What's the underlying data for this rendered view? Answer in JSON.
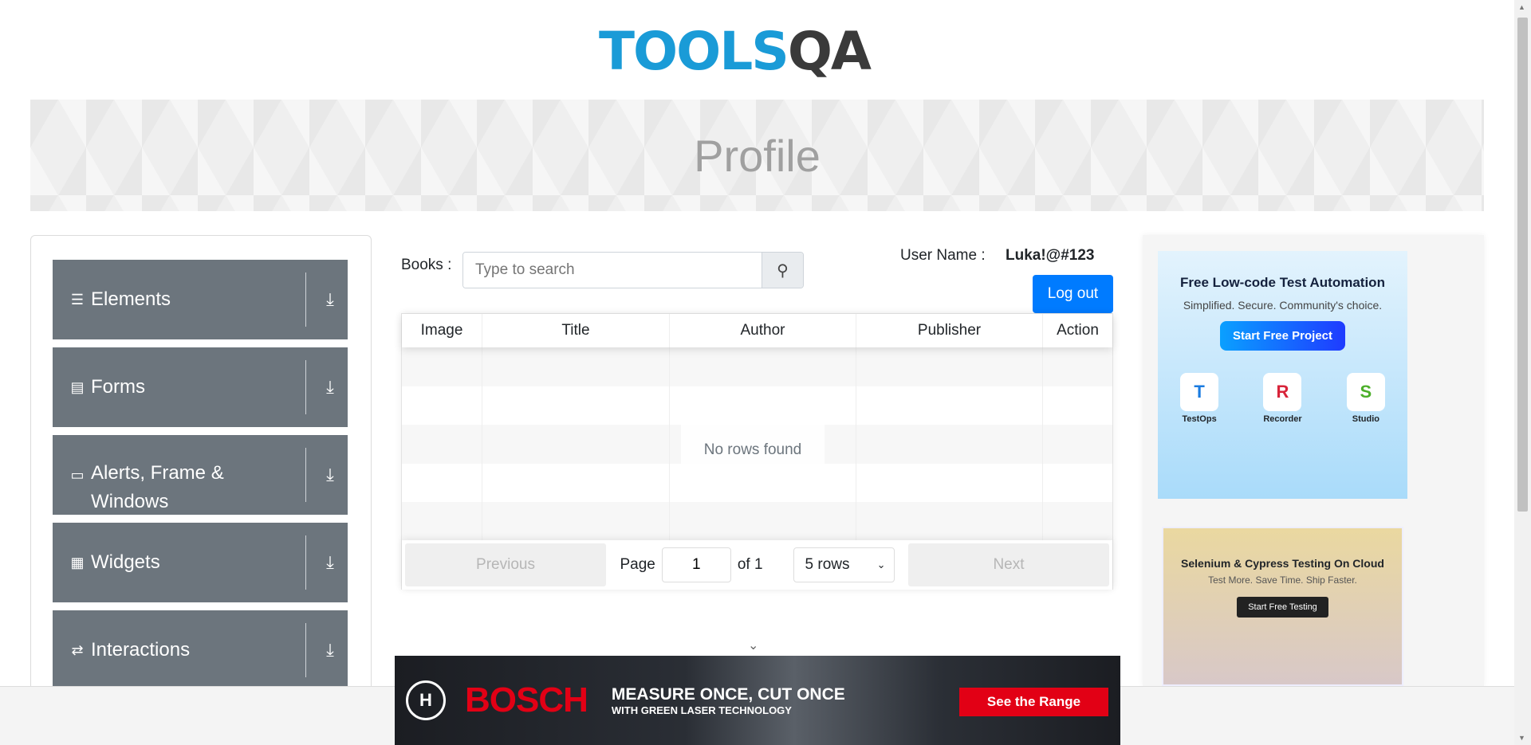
{
  "header": {
    "logo_text_1": "TOOLS",
    "logo_text_2": "QA",
    "title": "Profile"
  },
  "sidebar": {
    "items": [
      {
        "label": "Elements",
        "icon": "list-icon",
        "glyph": "☰"
      },
      {
        "label": "Forms",
        "icon": "form-icon",
        "glyph": "▤"
      },
      {
        "label": "Alerts, Frame & Windows",
        "icon": "window-icon",
        "glyph": "▭"
      },
      {
        "label": "Widgets",
        "icon": "widgets-icon",
        "glyph": "▦"
      },
      {
        "label": "Interactions",
        "icon": "interactions-icon",
        "glyph": "⇄"
      }
    ],
    "expand_glyph": "⤓"
  },
  "books": {
    "label": "Books :",
    "search_placeholder": "Type to search",
    "search_value": ""
  },
  "user": {
    "label": "User Name :",
    "value": "Luka!@#123",
    "logout": "Log out"
  },
  "table": {
    "columns": [
      "Image",
      "Title",
      "Author",
      "Publisher",
      "Action"
    ],
    "rows": [],
    "empty_text": "No rows found"
  },
  "pagination": {
    "previous": "Previous",
    "next": "Next",
    "page_label": "Page",
    "page": "1",
    "of_label": "of 1",
    "rows_option": "5 rows"
  },
  "ads": {
    "bosch": {
      "brand": "BOSCH",
      "headline": "MEASURE ONCE, CUT ONCE",
      "sub": "WITH GREEN LASER TECHNOLOGY",
      "cta": "See the Range"
    },
    "katalon": {
      "headline": "Free Low-code Test Automation",
      "sub": "Simplified. Secure. Community's choice.",
      "cta": "Start Free Project",
      "apps": [
        "TestOps",
        "Recorder",
        "Studio"
      ]
    },
    "lambdatest": {
      "headline": "Selenium & Cypress Testing On Cloud",
      "sub": "Test More. Save Time. Ship Faster.",
      "cta": "Start Free Testing"
    }
  },
  "colors": {
    "primary": "#007bff",
    "sidebar": "#6c757d",
    "logo_blue": "#1a9bd7"
  }
}
